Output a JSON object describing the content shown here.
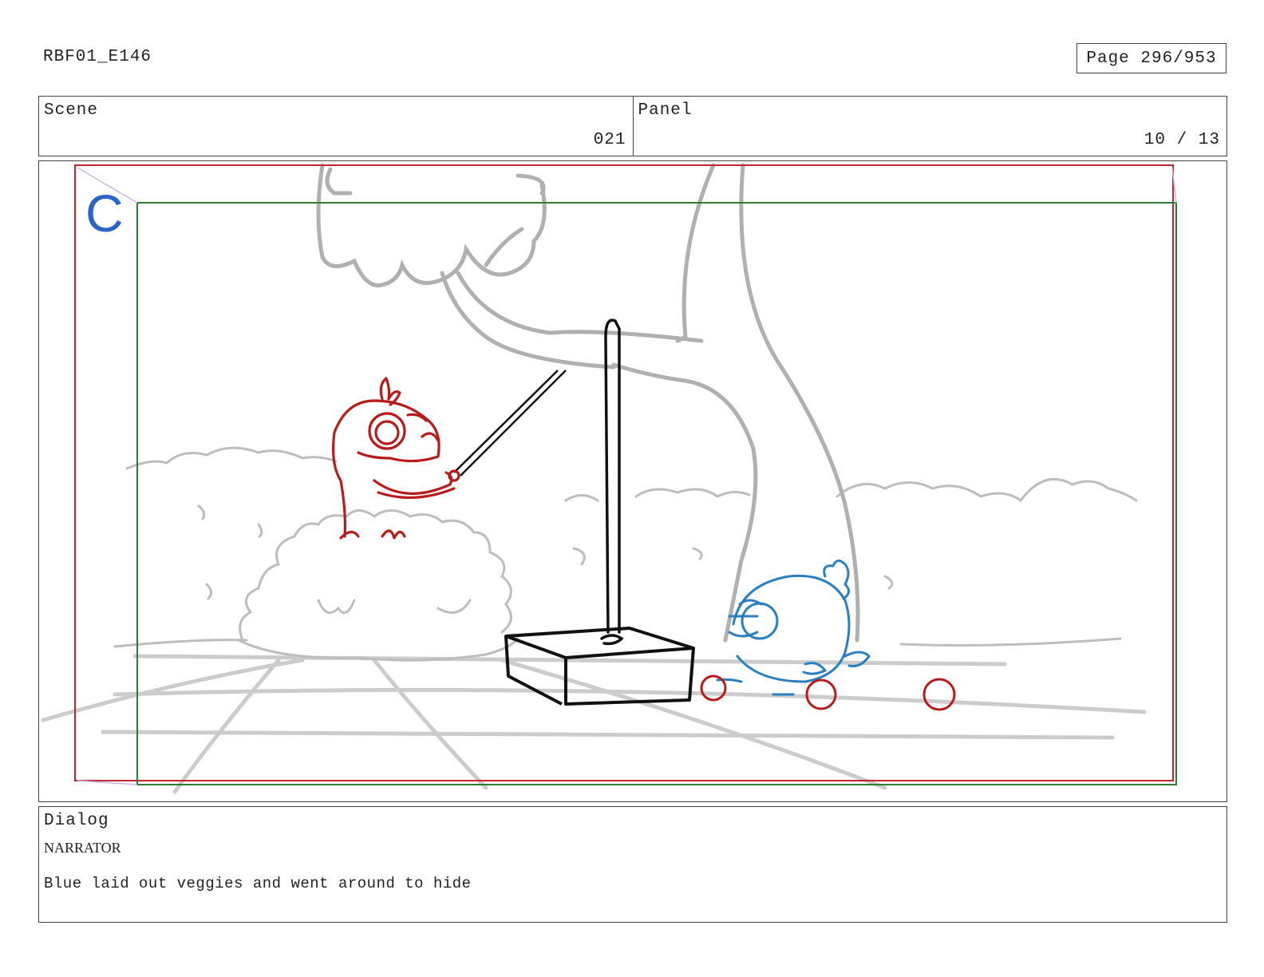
{
  "header": {
    "project": "RBF01_E146",
    "page": "Page 296/953"
  },
  "info": {
    "scene_label": "Scene",
    "scene_value": "021",
    "panel_label": "Panel",
    "panel_value": "10 / 13"
  },
  "frame": {
    "camera_marker": "C",
    "colors": {
      "action_safe": "#c0262b",
      "title_safe": "#2e7d32",
      "camera_marker": "#2b65c4",
      "red_character": "#b71c1c",
      "blue_character": "#2a7fc0",
      "background_lines": "#b3b3b3",
      "prop_lines": "#111111"
    }
  },
  "dialog": {
    "label": "Dialog",
    "speaker": "NARRATOR",
    "line": "Blue laid out veggies and went around to hide"
  }
}
